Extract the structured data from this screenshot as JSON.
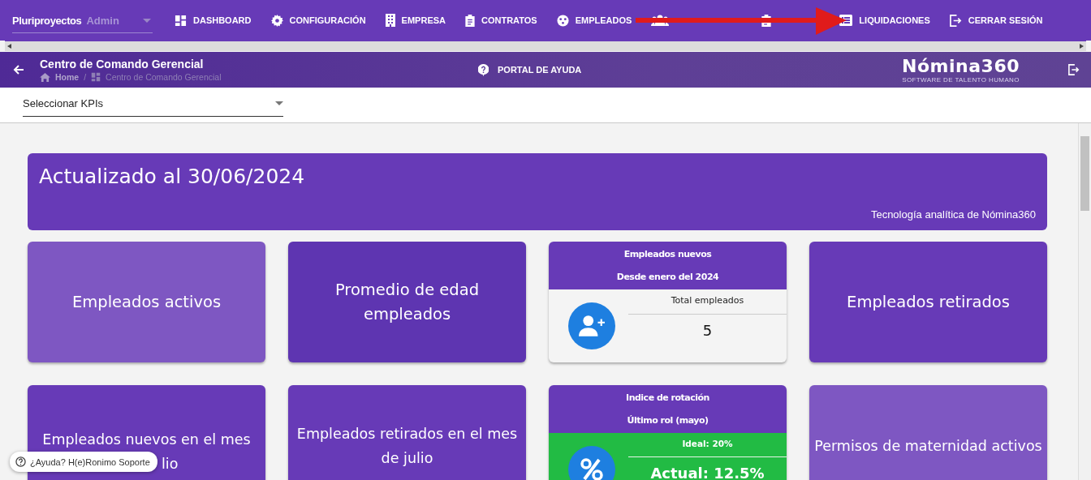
{
  "topbar": {
    "company": "Pluriproyectos",
    "role": "Admin",
    "nav": [
      {
        "kind": "link",
        "label": "DASHBOARD"
      },
      {
        "kind": "link",
        "label": "CONFIGURACIÓN"
      },
      {
        "kind": "link",
        "label": "EMPRESA"
      },
      {
        "kind": "link",
        "label": "CONTRATOS"
      },
      {
        "kind": "link",
        "label": "EMPLEADOS"
      },
      {
        "kind": "covered"
      },
      {
        "kind": "covered"
      },
      {
        "kind": "link",
        "label": "LIQUIDACIONES"
      },
      {
        "kind": "link",
        "label": "CERRAR SESIÓN"
      }
    ]
  },
  "header": {
    "title": "Centro de Comando Gerencial",
    "breadcrumb": [
      "Home",
      "Centro de Comando Gerencial"
    ],
    "breadcrumb_separator": "/",
    "help": "PORTAL DE AYUDA",
    "logo": "Nómina360",
    "logo_tagline": "SOFTWARE DE TALENTO HUMANO"
  },
  "kpi_select": {
    "placeholder": "Seleccionar KPIs"
  },
  "banner": {
    "title": "Actualizado al 30/06/2024",
    "caption": "Tecnología analítica de Nómina360"
  },
  "cards": [
    {
      "kind": "title",
      "color": "#7e57c2",
      "title": "Empleados activos"
    },
    {
      "kind": "title",
      "color": "#5e35b1",
      "title": "Promedio de edad empleados"
    },
    {
      "kind": "stat",
      "color": "#673ab7",
      "header": [
        "Empleados nuevos",
        "Desde enero del 2024"
      ],
      "label": "Total empleados",
      "value": "5"
    },
    {
      "kind": "title",
      "color": "#673ab7",
      "title": "Empleados retirados"
    },
    {
      "kind": "covered_title",
      "color": "#673ab7",
      "title_lines": [
        "Empleados nuevos en el mes",
        "lio"
      ]
    },
    {
      "kind": "title",
      "color": "#673ab7",
      "title": "Empleados retirados en el mes de julio"
    },
    {
      "kind": "gauge",
      "color": "#673ab7",
      "header": [
        "Indice de rotación",
        "Último rol (mayo)"
      ],
      "label": "Ideal: 20%",
      "value": "Actual: 12.5%"
    },
    {
      "kind": "title",
      "color": "#7e57c2",
      "title": "Permisos de maternidad activos"
    }
  ],
  "help_chip": "¿Ayuda? H(e)Ronimo Soporte"
}
